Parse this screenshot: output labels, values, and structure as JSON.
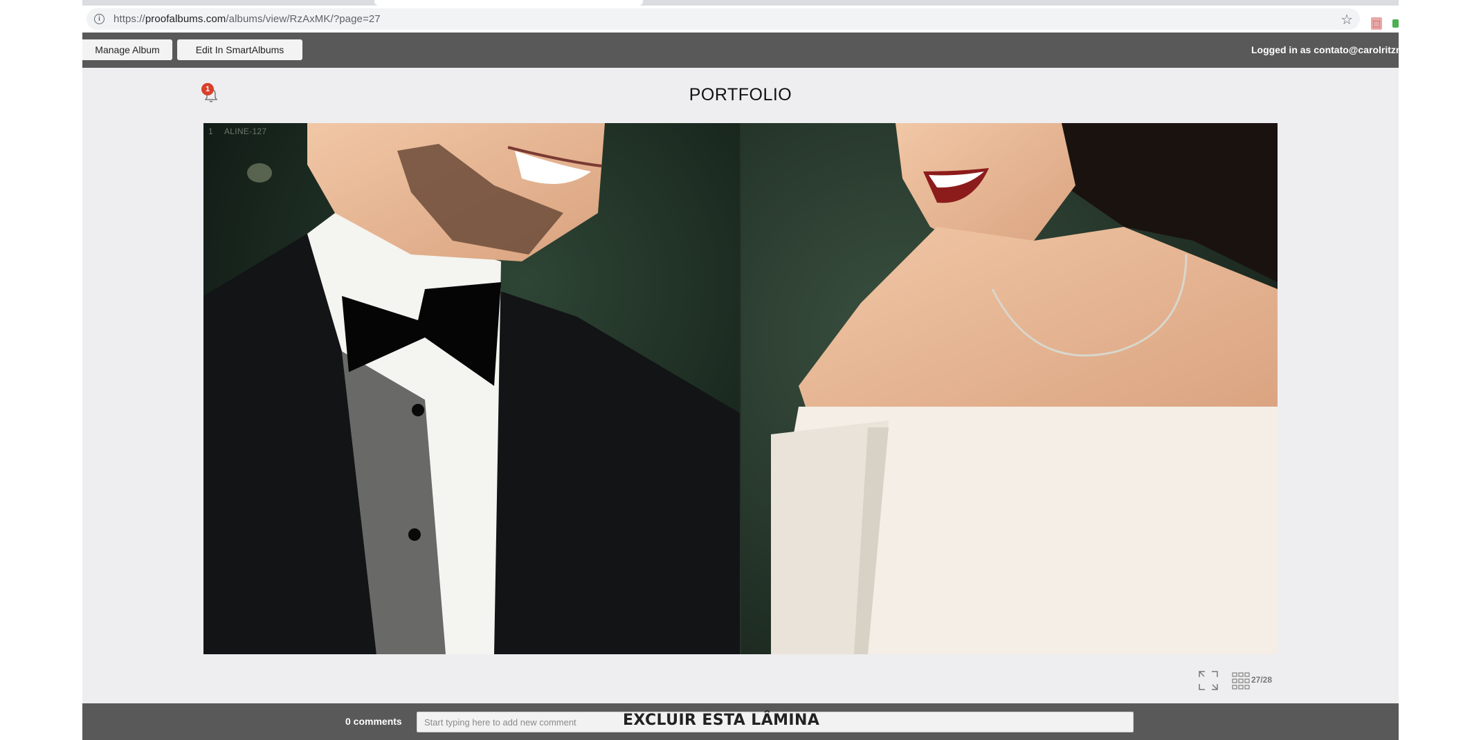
{
  "browser": {
    "url_prefix": "https://",
    "url_host": "proofalbums.com",
    "url_path": "/albums/view/RzAxMK/?page=27"
  },
  "toolbar": {
    "manage_album_label": "Manage Album",
    "edit_smartalbums_label": "Edit In SmartAlbums",
    "logged_in_text": "Logged in as contato@carolritzma"
  },
  "notifications": {
    "count": "1"
  },
  "album": {
    "title": "PORTFOLIO",
    "page_number": "1",
    "page_name": "ALINE-127",
    "page_indicator": "27/28"
  },
  "comments": {
    "count_label": "0 comments",
    "placeholder": "Start typing here to add new comment"
  },
  "overlay_caption": "EXCLUIR ESTA LÂMINA",
  "icons": {
    "info": "info-icon",
    "star": "star-icon",
    "pdf": "pdf-extension-icon",
    "bell": "bell-icon",
    "expand": "expand-icon",
    "grid": "grid-icon"
  },
  "colors": {
    "toolbar_bg": "#595959",
    "page_bg": "#eeeef0",
    "badge": "#d7402a"
  }
}
